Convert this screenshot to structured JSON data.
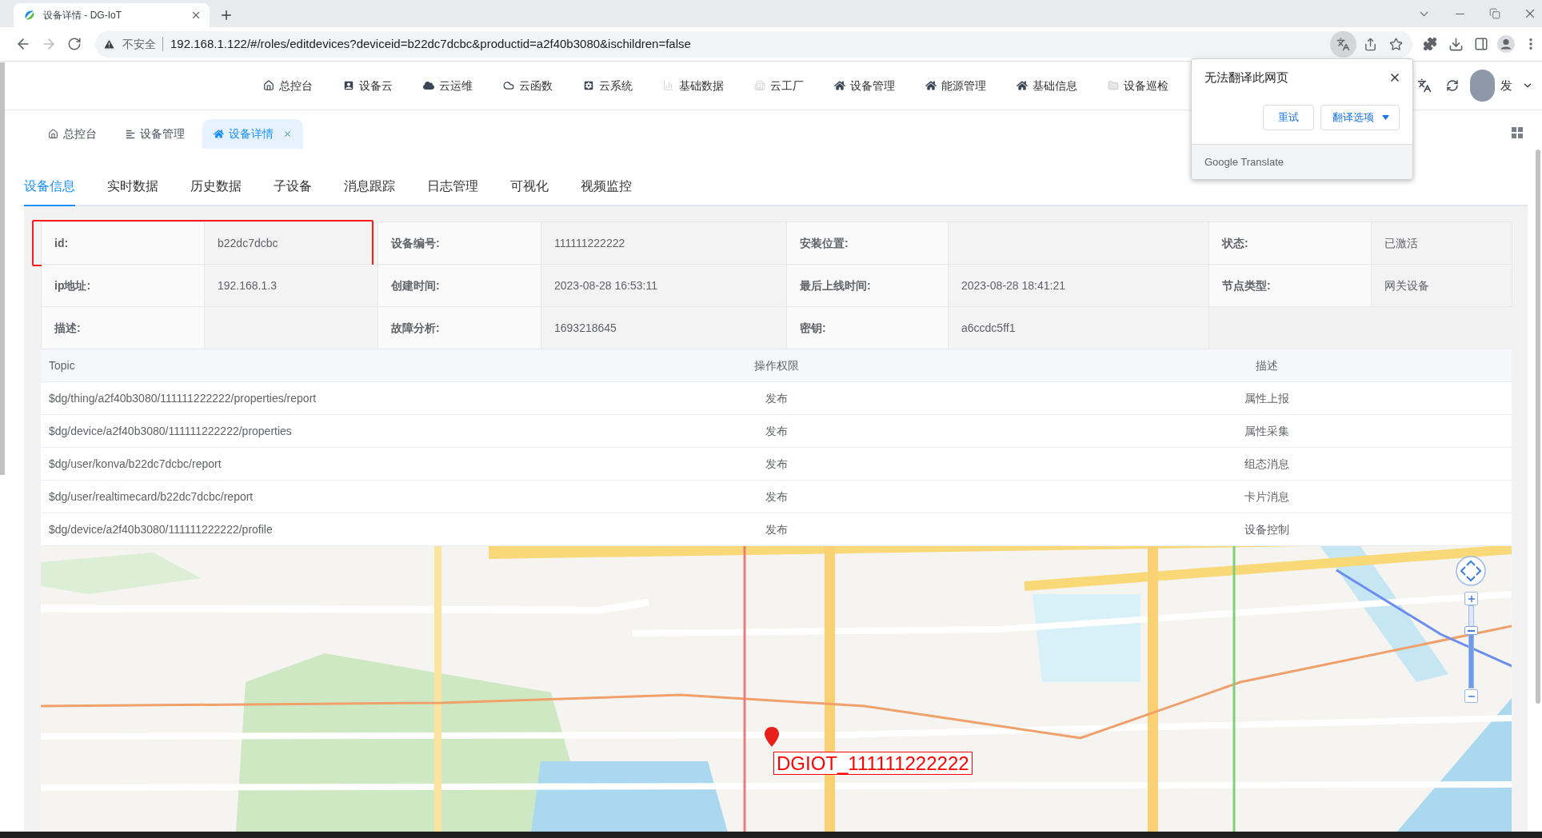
{
  "browser": {
    "tab_title": "设备详情 - DG-IoT",
    "security_label": "不安全",
    "url": "192.168.1.122/#/roles/editdevices?deviceid=b22dc7dcbc&productid=a2f40b3080&ischildren=false"
  },
  "top_menu": [
    "总控台",
    "设备云",
    "云运维",
    "云函数",
    "云系统",
    "基础数据",
    "云工厂",
    "设备管理",
    "能源管理",
    "基础信息",
    "设备巡检"
  ],
  "user": {
    "name": "发"
  },
  "translate_popup": {
    "title": "无法翻译此网页",
    "buttons": [
      {
        "label": "重试",
        "kind": "plain"
      },
      {
        "label": "翻译选项",
        "kind": "menu"
      }
    ],
    "footer": "Google Translate"
  },
  "page_tabs": [
    {
      "label": "总控台",
      "selected": false
    },
    {
      "label": "设备管理",
      "selected": false
    },
    {
      "label": "设备详情",
      "selected": true
    }
  ],
  "tabs": [
    {
      "label": "设备信息",
      "selected": true
    },
    {
      "label": "实时数据",
      "selected": false
    },
    {
      "label": "历史数据",
      "selected": false
    },
    {
      "label": "子设备",
      "selected": false
    },
    {
      "label": "消息跟踪",
      "selected": false
    },
    {
      "label": "日志管理",
      "selected": false
    },
    {
      "label": "可视化",
      "selected": false
    },
    {
      "label": "视频监控",
      "selected": false
    }
  ],
  "device_info": [
    {
      "label": "id:",
      "value": "b22dc7dcbc",
      "highlighted": true
    },
    {
      "label": "设备编号:",
      "value": "111111222222",
      "highlighted": false
    },
    {
      "label": "安装位置:",
      "highlighted": false
    },
    {
      "label": "状态:",
      "value": "已激活",
      "highlighted": false
    },
    {
      "label": "ip地址:",
      "value": "192.168.1.3",
      "highlighted": false
    },
    {
      "label": "创建时间:",
      "value": "2023-08-28 16:53:11",
      "highlighted": false
    },
    {
      "label": "最后上线时间:",
      "value": "2023-08-28 18:41:21",
      "highlighted": false
    },
    {
      "label": "节点类型:",
      "value": "网关设备",
      "highlighted": false
    },
    {
      "label": "描述:",
      "highlighted": false
    },
    {
      "label": "故障分析:",
      "value": "1693218645",
      "highlighted": false
    },
    {
      "label": "密钥:",
      "value": "a6ccdc5ff1",
      "highlighted": false
    }
  ],
  "topic_table": {
    "columns": [
      "Topic",
      "操作权限",
      "描述"
    ],
    "rows": [
      [
        "$dg/thing/a2f40b3080/111111222222/properties/report",
        "发布",
        "属性上报"
      ],
      [
        "$dg/device/a2f40b3080/111111222222/properties",
        "发布",
        "属性采集"
      ],
      [
        "$dg/user/konva/b22dc7dcbc/report",
        "发布",
        "组态消息"
      ],
      [
        "$dg/user/realtimecard/b22dc7dcbc/report",
        "发布",
        "卡片消息"
      ],
      [
        "$dg/device/a2f40b3080/111111222222/profile",
        "发布",
        "设备控制"
      ]
    ]
  },
  "map": {
    "marker_label": "DGIOT_111111222222",
    "zoom_slider": {
      "level": 0.69
    }
  }
}
